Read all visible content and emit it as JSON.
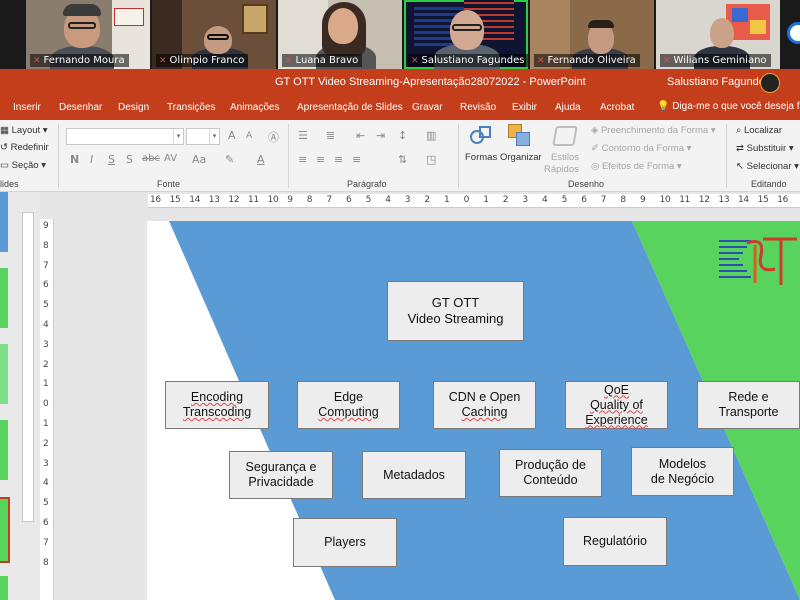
{
  "meeting": {
    "participants": [
      {
        "name": "Fernando Moura",
        "muted": true
      },
      {
        "name": "Olimpio Franco",
        "muted": true
      },
      {
        "name": "Luana Bravo",
        "muted": true
      },
      {
        "name": "Salustiano Fagundes",
        "muted": true,
        "active": true
      },
      {
        "name": "Fernando Oliveira",
        "muted": true
      },
      {
        "name": "Wilians Geminiano",
        "muted": true
      }
    ]
  },
  "window": {
    "doc_title": "GT OTT Video Streaming-Apresentação28072022  -  PowerPoint",
    "user_name": "Salustiano Fagundes"
  },
  "menu": {
    "tabs": [
      "Inserir",
      "Desenhar",
      "Design",
      "Transições",
      "Animações",
      "Apresentação de Slides",
      "Gravar",
      "Revisão",
      "Exibir",
      "Ajuda",
      "Acrobat"
    ],
    "tell_me": "Diga-me o que você deseja fazer"
  },
  "ribbon": {
    "slides_group": {
      "layout": "Layout",
      "reset": "Redefinir",
      "section": "Seção",
      "label": "lides"
    },
    "font_group": {
      "label": "Fonte",
      "bold": "N",
      "italic": "I",
      "underline": "S",
      "shadow": "S",
      "strike": "abc",
      "spacing": "AV",
      "case": "Aa",
      "grow": "A",
      "shrink": "A",
      "color": "A"
    },
    "paragraph_group": {
      "label": "Parágrafo"
    },
    "drawing_group": {
      "label": "Desenho",
      "shapes": "Formas",
      "arrange": "Organizar",
      "quick_styles_1": "Estilos",
      "quick_styles_2": "Rápidos",
      "shape_fill": "Preenchimento da Forma",
      "shape_outline": "Contorno da Forma",
      "shape_effects": "Efeitos de Forma"
    },
    "editing_group": {
      "label": "Editando",
      "find": "Localizar",
      "replace": "Substituir",
      "select": "Selecionar"
    }
  },
  "rulers": {
    "horizontal": [
      "16",
      "15",
      "14",
      "13",
      "12",
      "11",
      "10",
      "9",
      "8",
      "7",
      "6",
      "5",
      "4",
      "3",
      "2",
      "1",
      "0",
      "1",
      "2",
      "3",
      "4",
      "5",
      "6",
      "7",
      "8",
      "9",
      "10",
      "11",
      "12",
      "13",
      "14",
      "15",
      "16"
    ],
    "vertical": [
      "9",
      "8",
      "7",
      "6",
      "5",
      "4",
      "3",
      "2",
      "1",
      "0",
      "1",
      "2",
      "3",
      "4",
      "5",
      "6",
      "7",
      "8"
    ]
  },
  "slide": {
    "colors": {
      "blue": "#5b9bd5",
      "green": "#57d35e",
      "box_fill": "#ededed",
      "box_border": "#7a7a7a"
    },
    "title_line1": "GT OTT",
    "title_line2": "Video Streaming",
    "topics": {
      "encoding": [
        "Encoding",
        "Transcoding"
      ],
      "edge": [
        "Edge",
        "Computing"
      ],
      "cdn": [
        "CDN e Open",
        "Caching"
      ],
      "qoe": [
        "QoE",
        "Quality of",
        "Experience"
      ],
      "network": [
        "Rede e",
        "Transporte"
      ],
      "security": [
        "Segurança e",
        "Privacidade"
      ],
      "metadata": "Metadados",
      "production": [
        "Produção de",
        "Conteúdo"
      ],
      "business": [
        "Modelos",
        "de Negócio"
      ],
      "players": "Players",
      "regulatory": "Regulatório"
    }
  }
}
